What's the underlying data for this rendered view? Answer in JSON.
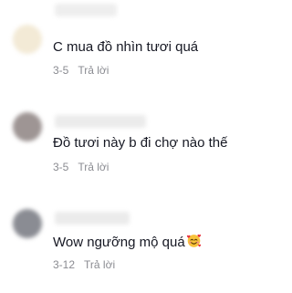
{
  "comments": [
    {
      "text": "C mua đồ nhìn tươi quá",
      "date": "3-5",
      "reply": "Trả lời",
      "avatar_color": "#f3ead6"
    },
    {
      "text": "Đồ tươi này b đi chợ nào thế",
      "date": "3-5",
      "reply": "Trả lời",
      "avatar_color": "#9e9594"
    },
    {
      "text": "Wow ngưỡng mộ quá",
      "emoji": "smiling-face-with-hearts-icon",
      "date": "3-12",
      "reply": "Trả lời",
      "avatar_color": "#8a8c93"
    }
  ]
}
